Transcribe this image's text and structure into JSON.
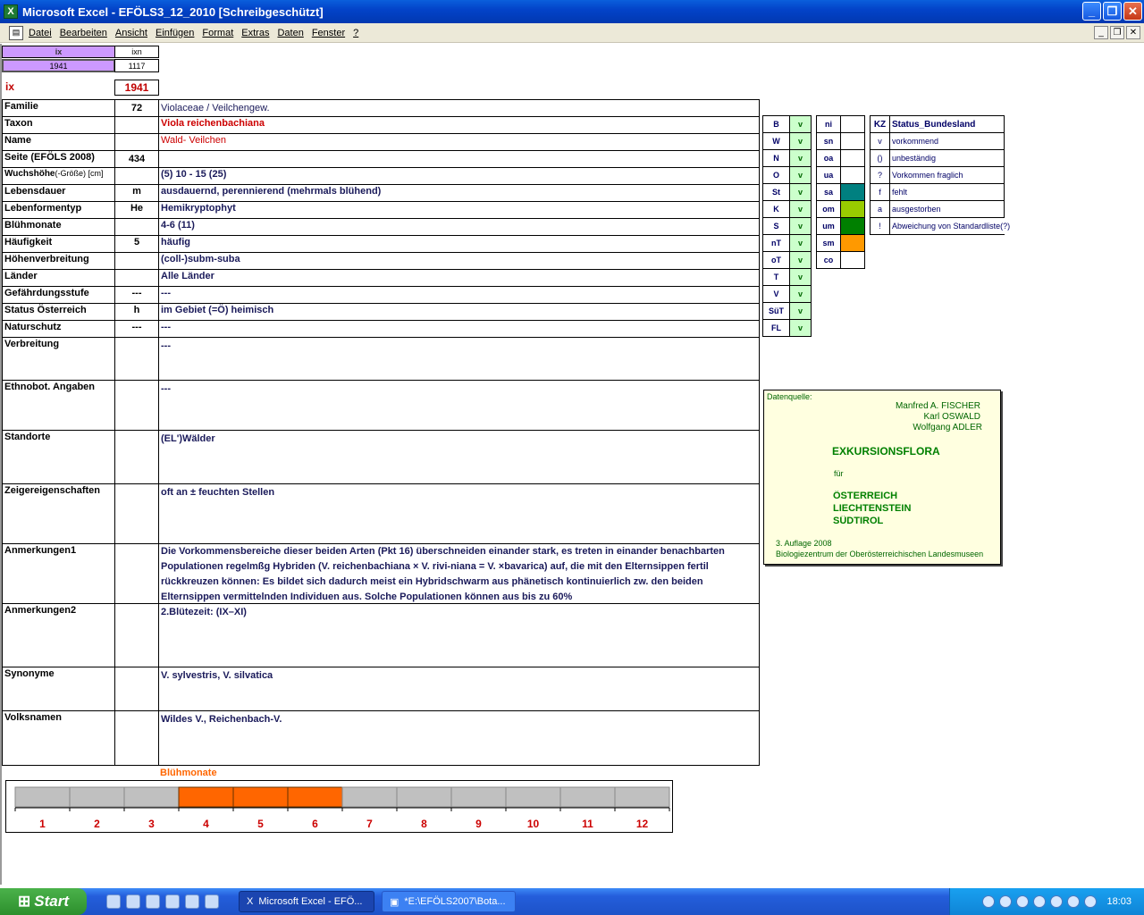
{
  "window": {
    "title": "Microsoft Excel - EFÖLS3_12_2010  [Schreibgeschützt]"
  },
  "menu": [
    "Datei",
    "Bearbeiten",
    "Ansicht",
    "Einfügen",
    "Format",
    "Extras",
    "Daten",
    "Fenster",
    "?"
  ],
  "top": {
    "h1": "ix",
    "h2": "ixn",
    "v1": "1941",
    "v2": "1117",
    "ix_label": "ix",
    "ix_value": "1941"
  },
  "rows": [
    {
      "label": "Familie",
      "num": "72",
      "value": "Violaceae / Veilchengew."
    },
    {
      "label": "Taxon",
      "num": "",
      "value": "Viola reichenbachiana"
    },
    {
      "label": "Name",
      "num": "",
      "value": "Wald- Veilchen"
    },
    {
      "label": "Seite (EFÖLS 2008)",
      "num": "434",
      "value": ""
    },
    {
      "label": "Wuchshöhe",
      "label_suffix": "(-Größe) [cm]",
      "num": "",
      "value": "(5) 10 - 15 (25)"
    },
    {
      "label": "Lebensdauer",
      "num": "m",
      "value": "ausdauernd, perennierend (mehrmals blühend)"
    },
    {
      "label": "Lebenformentyp",
      "num": "He",
      "value": "Hemikryptophyt"
    },
    {
      "label": "Blühmonate",
      "num": "",
      "value": "4-6 (11)"
    },
    {
      "label": "Häufigkeit",
      "num": "5",
      "value": "häufig"
    },
    {
      "label": "Höhenverbreitung",
      "num": "",
      "value": "(coll-)subm-suba"
    },
    {
      "label": "Länder",
      "num": "",
      "value": "Alle Länder"
    },
    {
      "label": "Gefährdungsstufe",
      "num": "---",
      "value": "---"
    },
    {
      "label": "Status Österreich",
      "num": "h",
      "value": "im Gebiet (=Ö) heimisch"
    },
    {
      "label": "Naturschutz",
      "num": "---",
      "value": "---"
    },
    {
      "label": "Verbreitung",
      "num": "",
      "value": "---"
    },
    {
      "label": "Ethnobot. Angaben",
      "num": "",
      "value": "---"
    },
    {
      "label": "Standorte",
      "num": "",
      "value": "(EL')Wälder"
    },
    {
      "label": "Zeigereigenschaften",
      "num": "",
      "value": "oft an ± feuchten Stellen"
    },
    {
      "label": "Anmerkungen1",
      "num": "",
      "value": "Die Vorkommensbereiche dieser beiden Arten (Pkt 16) überschneiden einander stark, es treten in einander benachbarten Populationen regelmßg Hybriden (V. reichenbachiana × V. rivi-niana = V. ×bavarica) auf, die mit den Elternsippen fertil rückkreuzen können: Es bildet sich dadurch meist ein Hybridschwarm aus phänetisch kontinuierlich zw. den beiden Elternsippen vermittelnden Individuen aus. Solche Populationen können aus bis zu 60%"
    },
    {
      "label": "Anmerkungen2",
      "num": "",
      "value": "2.Blütezeit: (IX–XI)"
    },
    {
      "label": "Synonyme",
      "num": "",
      "value": "V. sylvestris, V. silvatica"
    },
    {
      "label": "Volksnamen",
      "num": "",
      "value": "Wildes V., Reichenbach-V."
    }
  ],
  "states": [
    {
      "code": "B",
      "val": "v"
    },
    {
      "code": "W",
      "val": "v"
    },
    {
      "code": "N",
      "val": "v"
    },
    {
      "code": "O",
      "val": "v"
    },
    {
      "code": "St",
      "val": "v"
    },
    {
      "code": "K",
      "val": "v"
    },
    {
      "code": "S",
      "val": "v"
    },
    {
      "code": "nT",
      "val": "v"
    },
    {
      "code": "oT",
      "val": "v"
    },
    {
      "code": "T",
      "val": "v"
    },
    {
      "code": "V",
      "val": "v"
    },
    {
      "code": "SüT",
      "val": "v"
    },
    {
      "code": "FL",
      "val": "v"
    }
  ],
  "altitude": [
    {
      "code": "ni",
      "color": ""
    },
    {
      "code": "sn",
      "color": ""
    },
    {
      "code": "oa",
      "color": ""
    },
    {
      "code": "ua",
      "color": ""
    },
    {
      "code": "sa",
      "color": "#008080"
    },
    {
      "code": "om",
      "color": "#99cc00"
    },
    {
      "code": "um",
      "color": "#008000"
    },
    {
      "code": "sm",
      "color": "#ff9900"
    },
    {
      "code": "co",
      "color": ""
    }
  ],
  "legend": {
    "header_code": "KZ",
    "header_label": "Status_Bundesland",
    "items": [
      {
        "code": "v",
        "label": "vorkommend"
      },
      {
        "code": "()",
        "label": "unbeständig"
      },
      {
        "code": "?",
        "label": "Vorkommen fraglich"
      },
      {
        "code": "f",
        "label": "fehlt"
      },
      {
        "code": "a",
        "label": "ausgestorben"
      },
      {
        "code": "!",
        "label": "Abweichung von Standardliste(?)"
      }
    ]
  },
  "source": {
    "label": "Datenquelle:",
    "authors": [
      "Manfred A. FISCHER",
      "Karl OSWALD",
      "Wolfgang ADLER"
    ],
    "title": "EXKURSIONSFLORA",
    "fuer": "für",
    "countries": [
      "ÖSTERREICH",
      "LIECHTENSTEIN",
      "SÜDTIROL"
    ],
    "edition": "3. Auflage 2008",
    "publisher": "Biologiezentrum der Oberösterreichischen Landesmuseen"
  },
  "bluehmonate": {
    "title": "Blühmonate",
    "months": [
      "1",
      "2",
      "3",
      "4",
      "5",
      "6",
      "7",
      "8",
      "9",
      "10",
      "11",
      "12"
    ],
    "active": [
      4,
      5,
      6
    ],
    "active_color": "#ff6600",
    "inactive_color": "#c0c0c0"
  },
  "taskbar": {
    "start": "Start",
    "tasks": [
      "Microsoft Excel - EFÖ...",
      "*E:\\EFÖLS2007\\Bota..."
    ],
    "clock": "18:03"
  }
}
